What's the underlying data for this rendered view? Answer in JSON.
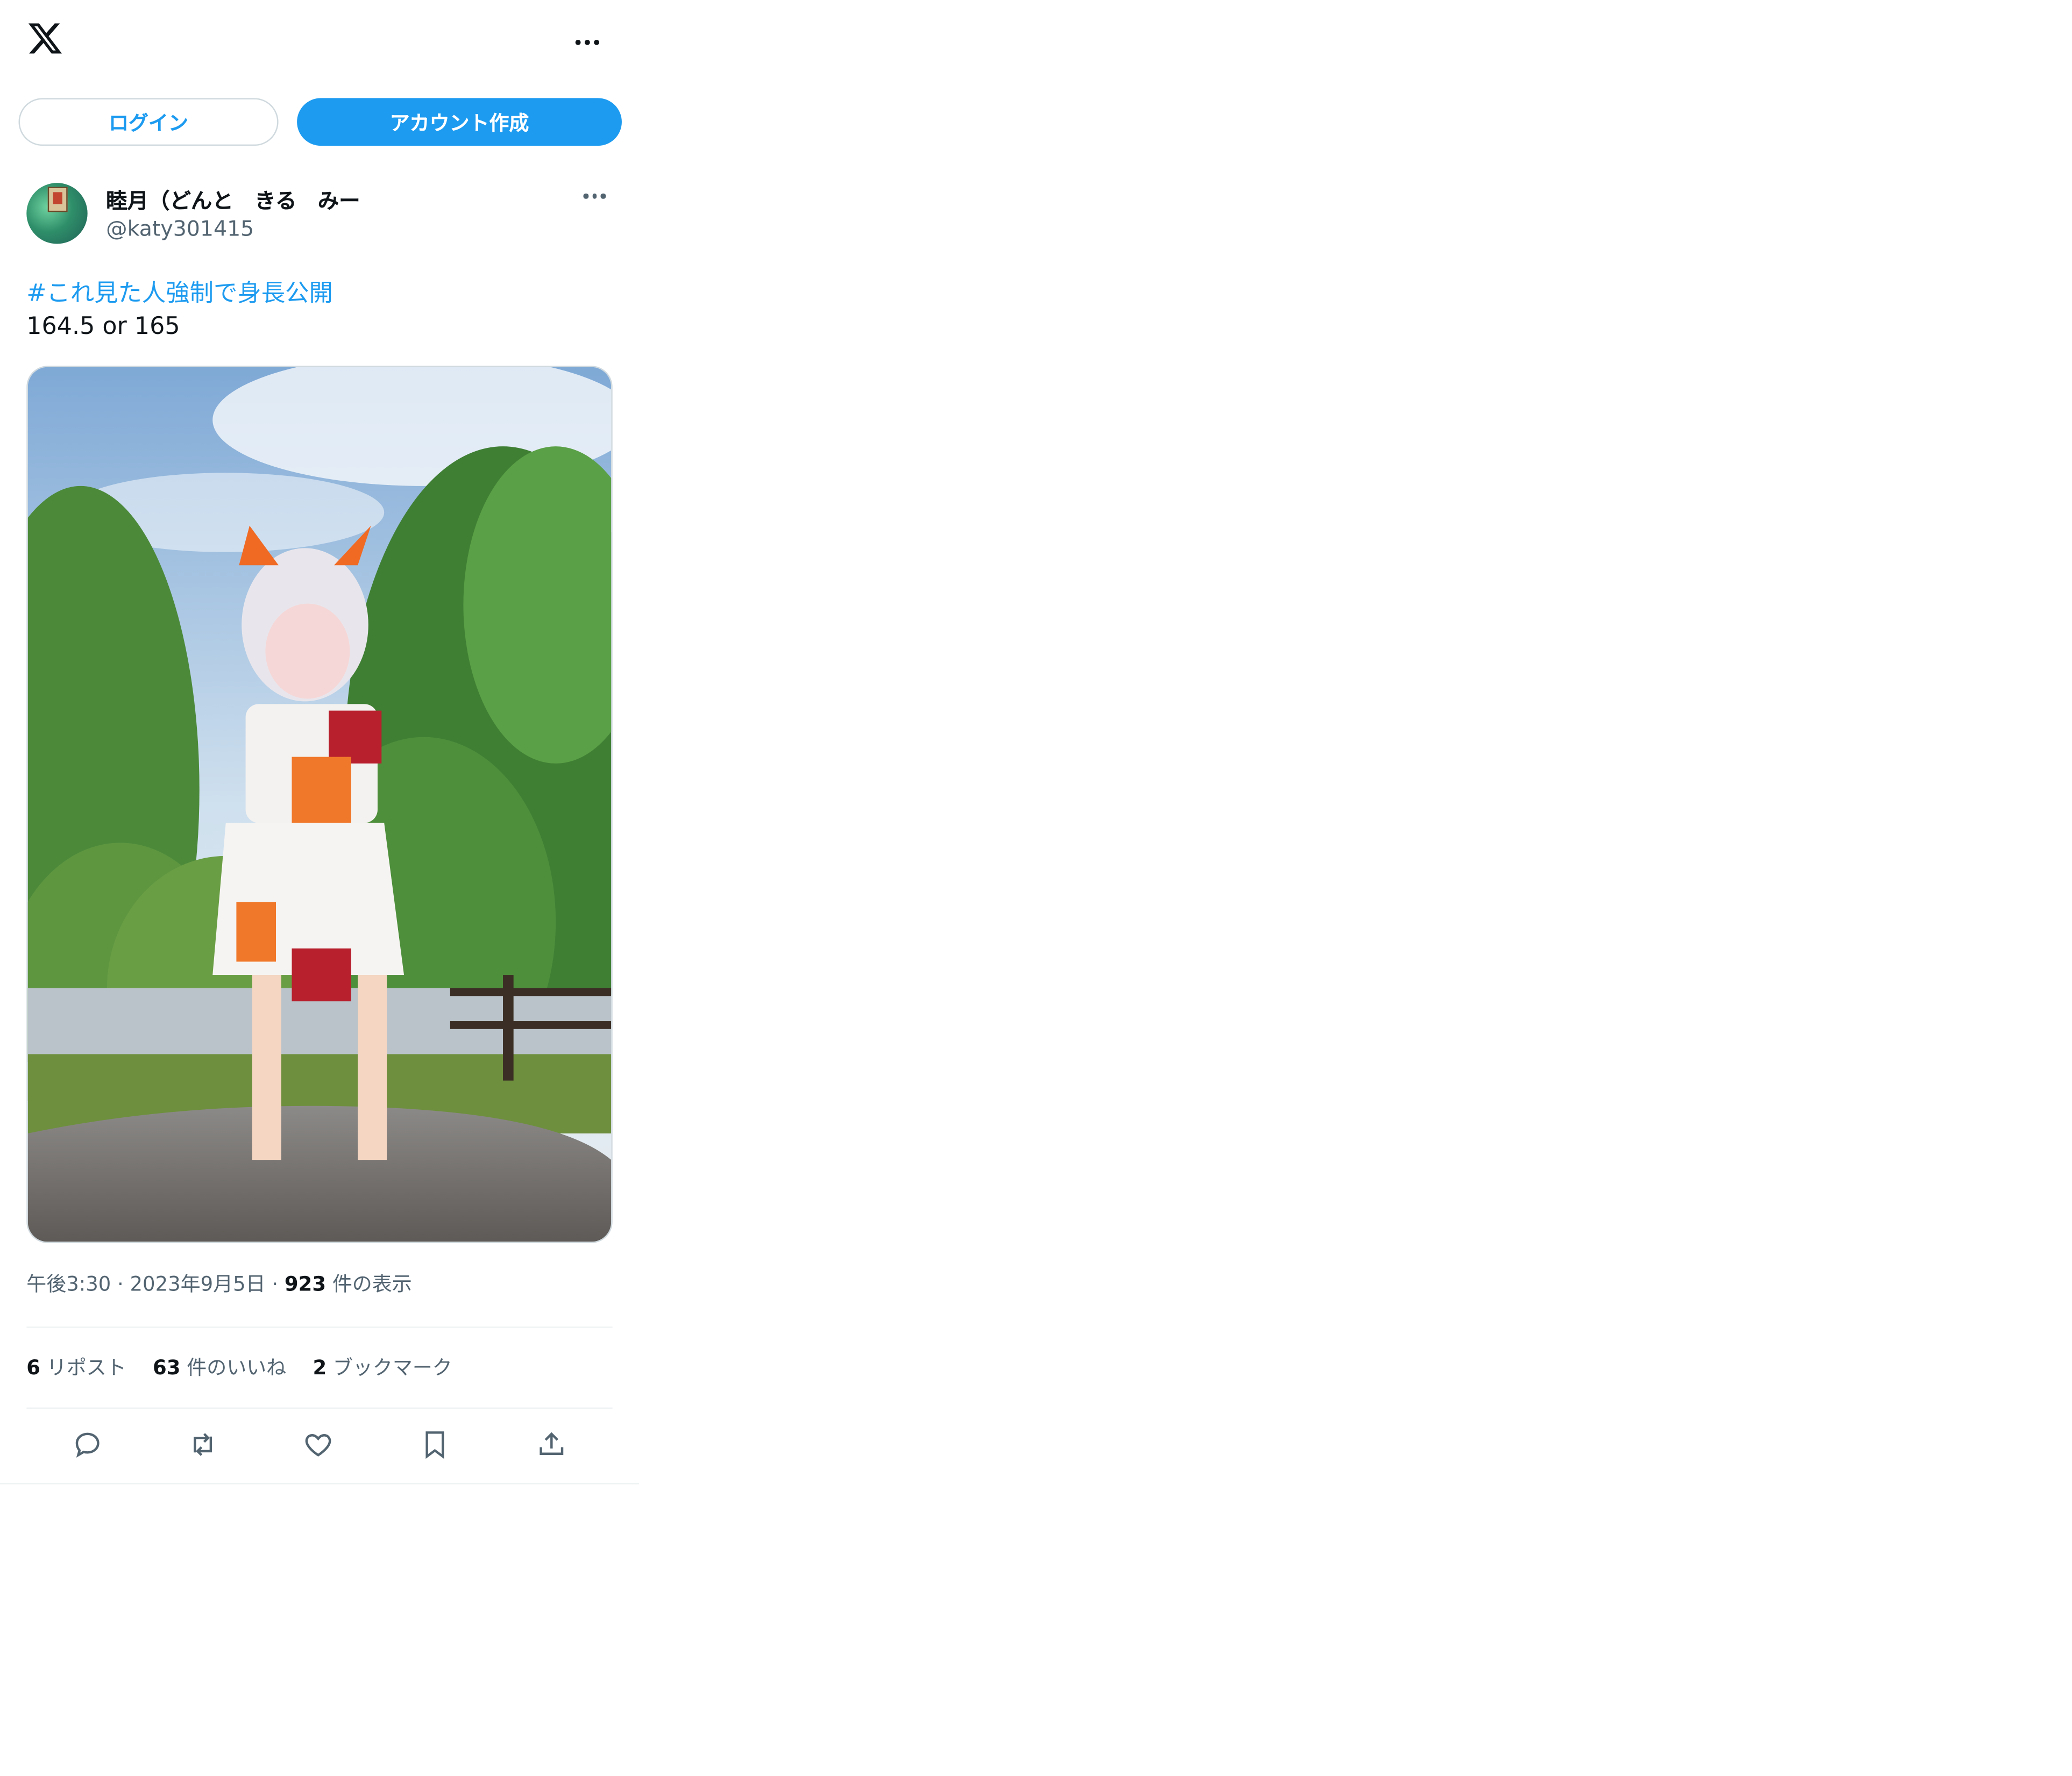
{
  "header": {
    "logo_icon": "x-logo-icon",
    "more_icon": "more-horizontal-icon"
  },
  "auth": {
    "login_label": "ログイン",
    "signup_label": "アカウント作成"
  },
  "tweet": {
    "author": {
      "display_name": "睦月（どんと　きる　みー",
      "handle": "@katy301415"
    },
    "hashtag": "#これ見た人強制で身長公開",
    "text": "164.5 or 165",
    "meta": {
      "time": "午後3:30",
      "date": "2023年9月5日",
      "views_count": "923",
      "views_label": "件の表示"
    },
    "stats": {
      "reposts_count": "6",
      "reposts_label": "リポスト",
      "likes_count": "63",
      "likes_label": "件のいいね",
      "bookmarks_count": "2",
      "bookmarks_label": "ブックマーク"
    },
    "actions": [
      "reply-icon",
      "repost-icon",
      "like-icon",
      "bookmark-icon",
      "share-icon"
    ]
  },
  "colors": {
    "accent": "#1d9bf0",
    "text_primary": "#0f1419",
    "text_secondary": "#536471",
    "border": "#cfd9de"
  }
}
